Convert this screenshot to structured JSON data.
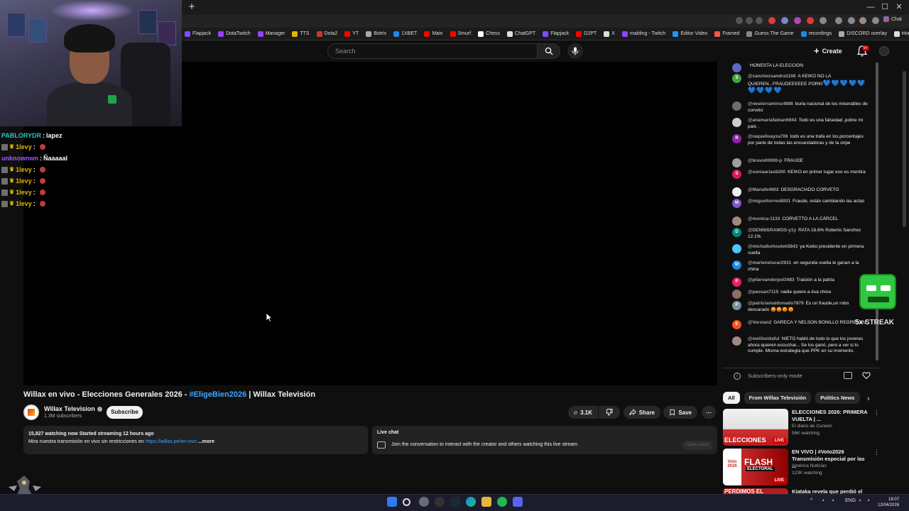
{
  "browser": {
    "new_tab": "+",
    "window_controls": [
      "—",
      "☐",
      "✕"
    ],
    "bookmarks": [
      {
        "label": "Flapjack",
        "color": "#7c4dff"
      },
      {
        "label": "DotaTwitch",
        "color": "#9146ff"
      },
      {
        "label": "Manager",
        "color": "#9146ff"
      },
      {
        "label": "TTS",
        "color": "#e2b400"
      },
      {
        "label": "Dota2",
        "color": "#c23b3b"
      },
      {
        "label": "YT",
        "color": "#ff0000"
      },
      {
        "label": "Botrix",
        "color": "#aaaaaa"
      },
      {
        "label": "1XBET",
        "color": "#1e88e5"
      },
      {
        "label": "Main",
        "color": "#ff0000"
      },
      {
        "label": "Smurf",
        "color": "#ff0000"
      },
      {
        "label": "Chess",
        "color": "#ffffff"
      },
      {
        "label": "ChatGPT",
        "color": "#dddddd"
      },
      {
        "label": "Flapjack",
        "color": "#7c4dff"
      },
      {
        "label": "D2PT",
        "color": "#ff0000"
      },
      {
        "label": "X",
        "color": "#dddddd"
      },
      {
        "label": "malding - Twitch",
        "color": "#9146ff"
      },
      {
        "label": "Editor Video",
        "color": "#2196f3"
      },
      {
        "label": "Framed",
        "color": "#ff5252"
      },
      {
        "label": "Guess The Game",
        "color": "#888888"
      },
      {
        "label": "recordings",
        "color": "#1e88e5"
      },
      {
        "label": "DISCORD overlay",
        "color": "#aaaaaa"
      },
      {
        "label": "Hora en Madrid",
        "color": "#dddddd"
      }
    ],
    "chat_extension": "Chat"
  },
  "header": {
    "search_placeholder": "Search",
    "create_label": "Create",
    "notifications_badge": "9+"
  },
  "overlay": {
    "twitch_chat": [
      {
        "user": "PABLORYDR",
        "user_color": "#27c7c7",
        "message": "lapez",
        "badges": false,
        "emote": false
      },
      {
        "user": "1levy",
        "user_color": "#e2b400",
        "message": "",
        "badges": true,
        "emote": true
      },
      {
        "user": "unknownwn",
        "user_color": "#9b5cff",
        "message": "Ñaaaaal",
        "badges": false,
        "emote": false
      },
      {
        "user": "1levy",
        "user_color": "#e2b400",
        "message": "",
        "badges": true,
        "emote": true
      },
      {
        "user": "1levy",
        "user_color": "#e2b400",
        "message": "",
        "badges": true,
        "emote": true
      },
      {
        "user": "1levy",
        "user_color": "#e2b400",
        "message": "",
        "badges": true,
        "emote": true
      },
      {
        "user": "1levy",
        "user_color": "#e2b400",
        "message": "",
        "badges": true,
        "emote": true
      }
    ],
    "streak_label": "5x STREAK"
  },
  "video": {
    "title_prefix": "Willax en vivo - Elecciones Generales 2026 - ",
    "hashtag": "#EligeBien2026",
    "title_suffix": " | Willax Televisión",
    "channel_name": "Willax Television",
    "subscribers": "1.3M subscribers",
    "subscribe_label": "Subscribe",
    "likes": "3.1K",
    "share_label": "Share",
    "save_label": "Save",
    "more_label": "⋯",
    "description_stats": "15,827 watching now  Started streaming 12 hours ago",
    "description_text": "Mira nuestra transmisión en vivo sin restricciones en ",
    "description_link": "https://willax.pe/en-vivo",
    "description_more": " ...more"
  },
  "live_chat_box": {
    "title": "Live chat",
    "text": "Join the conversation to interact with the creator and others watching this live stream.",
    "open_panel": "Open panel"
  },
  "chat": {
    "messages": [
      {
        "author": "",
        "text": "HONESTA LA ELECCION",
        "avatar": "",
        "color": "#5c6bc0",
        "hearts": ""
      },
      {
        "author": "@sanchezsandra1108",
        "text": "A KEIKO NO LA QUIEREN...FRAUDEEEEEE PORKI",
        "avatar": "S",
        "color": "#43a047",
        "hearts": "💙💙💙💙💙💙💙💙💙"
      },
      {
        "author": "@nestorramirez4898",
        "text": "burla nacional de los miserables de corveto",
        "avatar": "",
        "color": "#6d6d6d",
        "hearts": ""
      },
      {
        "author": "@anamariafabian6944",
        "text": "Todo es una falsedad ,pobre mi país .",
        "avatar": "",
        "color": "#cccccc",
        "hearts": ""
      },
      {
        "author": "@raquelloayza706",
        "text": "todo es una trafa en los.porcentajes por parte de todas las encuestadoras y de la onpe",
        "avatar": "R",
        "color": "#8e24aa",
        "hearts": ""
      },
      {
        "author": "@bravo00000-p",
        "text": "FRAUDE",
        "avatar": "",
        "color": "#9e9e9e",
        "hearts": ""
      },
      {
        "author": "@soniaarias6200",
        "text": "KEIKO en primer lugar eso es mentira",
        "avatar": "S",
        "color": "#d81b60",
        "hearts": ""
      },
      {
        "author": "@Mariafe4902",
        "text": "DESGRACIADO CORVETO",
        "avatar": "",
        "color": "#eeeeee",
        "hearts": ""
      },
      {
        "author": "@migueltorres8931",
        "text": "Fraude, están cambiando las actas",
        "avatar": "M",
        "color": "#7e57c2",
        "hearts": ""
      },
      {
        "author": "@monica-1133",
        "text": "CORVETTO A LA CÁRCEL",
        "avatar": "",
        "color": "#a1887f",
        "hearts": ""
      },
      {
        "author": "@DENNISRAMOS-y1y",
        "text": "RATA 16.6% Roberto Sanchez 12.1%",
        "avatar": "D",
        "color": "#00897b",
        "hearts": ""
      },
      {
        "author": "@michalkohoutek5843",
        "text": "ya Keiko presidente en primera vuelta",
        "avatar": "",
        "color": "#4fc3f7",
        "hearts": ""
      },
      {
        "author": "@marlenelucar2931",
        "text": "en segunda vuelta le ganan a la china",
        "avatar": "M",
        "color": "#1e88e5",
        "hearts": ""
      },
      {
        "author": "@pilarvanderpol3483",
        "text": "Traición a la patria",
        "avatar": "P",
        "color": "#e91e63",
        "hearts": ""
      },
      {
        "author": "@paosan7115",
        "text": "nadie quiere a ésa china",
        "avatar": "",
        "color": "#8d6e63",
        "hearts": ""
      },
      {
        "author": "@patriciamaldonado7879",
        "text": "Es un fraude,un robo descarado 😡😡😡😡",
        "avatar": "P",
        "color": "#78909c",
        "hearts": ""
      },
      {
        "author": "@Vorsian2",
        "text": "GARECA Y NELSON BONILLO REGRESAN",
        "avatar": "E",
        "color": "#f4511e",
        "hearts": ""
      },
      {
        "author": "@melilunitaful",
        "text": "NIETO habló de todo lo que los jovenes ahora quieren escuchar... Se los ganó, pero a ver si lo cumple. Misma estrategia que PPK en su momento.",
        "avatar": "",
        "color": "#a1887f",
        "hearts": ""
      }
    ],
    "footer_text": "Subscribers-only mode"
  },
  "recommendations": {
    "chips": [
      "All",
      "From Willax Televisión",
      "Politics News"
    ],
    "items": [
      {
        "title": "ELECCIONES 2026: PRIMERA VUELTA | ...",
        "channel": "El diario de Curwen",
        "views": "56K watching",
        "thumb_text": "ELECCIONES",
        "live": "LIVE"
      },
      {
        "title": "EN VIVO | #Voto2026 Transmisión especial por las ...",
        "channel": "América Noticias",
        "views": "123K watching",
        "thumb_text": "FLASH",
        "thumb_sub": "ELECTORAL",
        "thumb_left": "Voto 2026",
        "live": "LIVE"
      },
      {
        "title": "Kiataka revela que perdió el",
        "channel": "",
        "views": "",
        "thumb_text": "PERDIMOS EL",
        "live": ""
      }
    ]
  },
  "taskbar": {
    "lang": "ENG",
    "time": "18:07",
    "date": "12/04/2026"
  }
}
